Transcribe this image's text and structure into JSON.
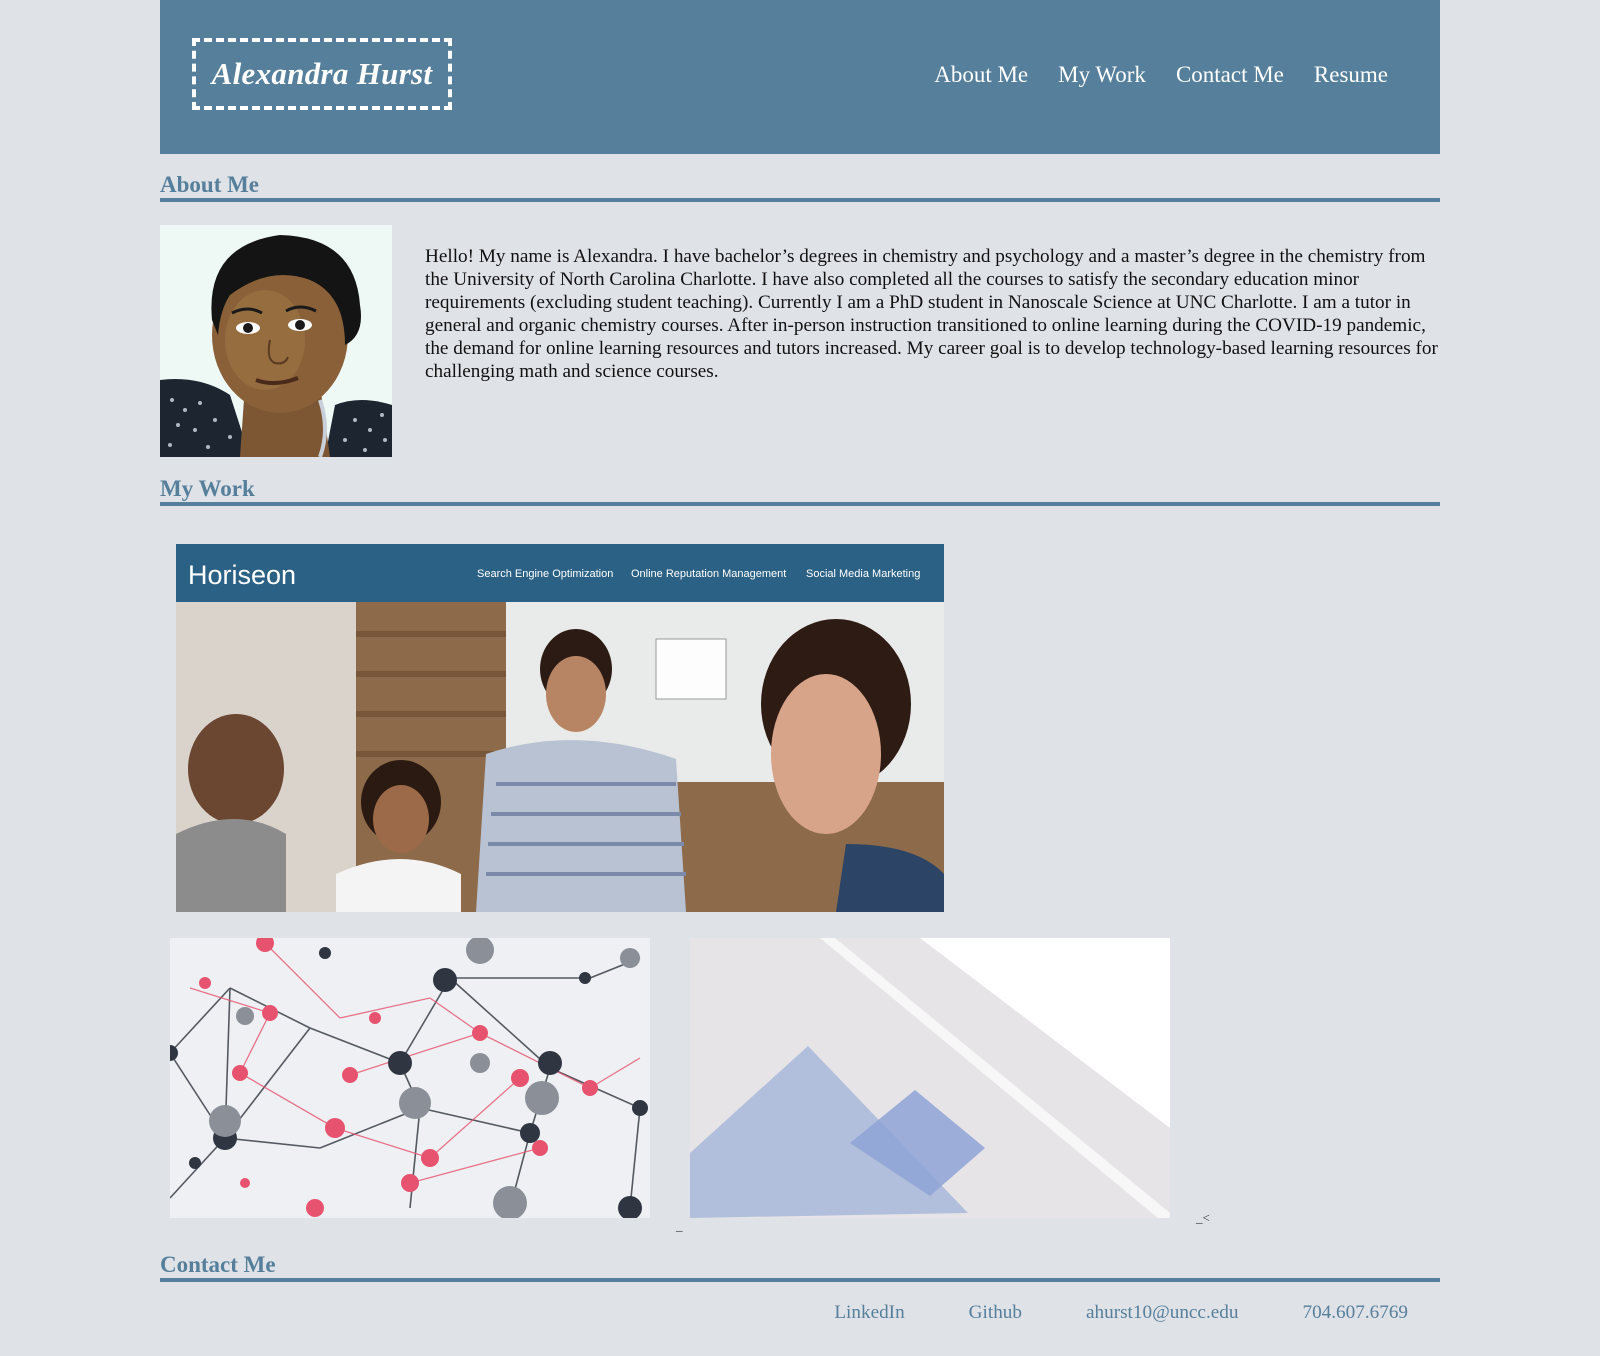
{
  "header": {
    "name": "Alexandra Hurst",
    "nav": [
      "About Me",
      "My Work",
      "Contact Me",
      "Resume"
    ]
  },
  "about": {
    "title": "About Me",
    "text": "Hello! My name is Alexandra. I have bachelor’s degrees in chemistry and psychology and a master’s degree in the chemistry from the University of North Carolina Charlotte. I have also completed all the courses to satisfy the secondary education minor requirements (excluding student teaching). Currently I am a PhD student in Nanoscale Science at UNC Charlotte. I am a tutor in general and organic chemistry courses. After in-person instruction transitioned to online learning during the COVID-19 pandemic, the demand for online learning resources and tutors increased. My career goal is to develop technology-based learning resources for challenging math and science courses."
  },
  "work": {
    "title": "My Work",
    "featured": {
      "brand": "Horiseon",
      "nav": [
        "Search Engine Optimization",
        "Online Reputation Management",
        "Social Media Marketing"
      ]
    },
    "stray_marks": [
      "_",
      "_<"
    ]
  },
  "contact": {
    "title": "Contact Me",
    "links": [
      "LinkedIn",
      "Github",
      "ahurst10@uncc.edu",
      "704.607.6769"
    ]
  },
  "colors": {
    "accent": "#567f9b",
    "background": "#dfe2e7"
  }
}
